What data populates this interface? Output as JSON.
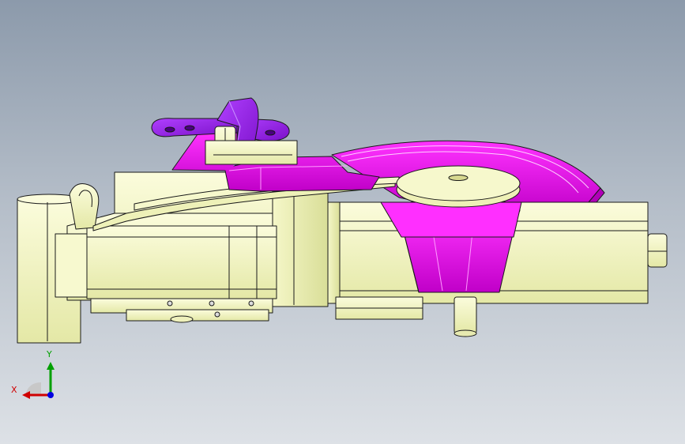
{
  "viewport": {
    "background_top": "#8c9aab",
    "background_bottom": "#dde1e6"
  },
  "model": {
    "part_color_primary": "#f2f5c4",
    "part_color_accent": "#e600e6",
    "edge_color": "#1a1a1a"
  },
  "triad": {
    "x_label": "X",
    "y_label": "Y",
    "x_color": "#d00000",
    "y_color": "#00a000",
    "z_color": "#0000e0"
  }
}
